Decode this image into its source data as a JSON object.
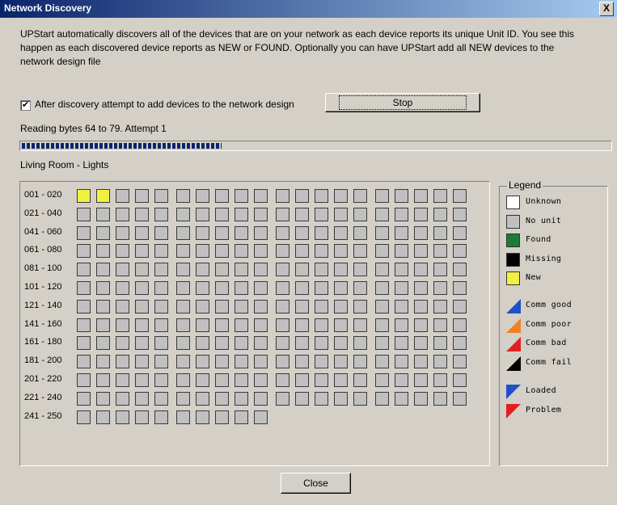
{
  "window": {
    "title": "Network Discovery",
    "close_glyph": "X"
  },
  "description": "UPStart automatically discovers all of the devices that are on your network as each device reports its unique Unit ID.  You see this happen as each discovered device reports as NEW or FOUND.  Optionally you can have UPStart add all NEW devices to the network design file",
  "add_devices": {
    "checked": true,
    "check_glyph": "✔",
    "label": "After discovery attempt to add devices to the network design"
  },
  "stop_label": "Stop",
  "status_text": "Reading bytes 64 to 79.  Attempt 1",
  "progress": {
    "fraction": 0.34
  },
  "room_name": "Living Room - Lights",
  "grid": {
    "rows": [
      {
        "label": "001 - 020",
        "count": 20,
        "states": [
          "new",
          "new"
        ]
      },
      {
        "label": "021 - 040",
        "count": 20
      },
      {
        "label": "041 - 060",
        "count": 20
      },
      {
        "label": "061 - 080",
        "count": 20
      },
      {
        "label": "081 - 100",
        "count": 20
      },
      {
        "label": "101 - 120",
        "count": 20
      },
      {
        "label": "121 - 140",
        "count": 20
      },
      {
        "label": "141 - 160",
        "count": 20
      },
      {
        "label": "161 - 180",
        "count": 20
      },
      {
        "label": "181 - 200",
        "count": 20
      },
      {
        "label": "201 - 220",
        "count": 20
      },
      {
        "label": "221 - 240",
        "count": 20
      },
      {
        "label": "241 - 250",
        "count": 10
      }
    ]
  },
  "legend": {
    "title": "Legend",
    "states": [
      {
        "label": "Unknown",
        "color": "#ffffff"
      },
      {
        "label": "No unit",
        "color": "#c0c0c0"
      },
      {
        "label": "Found",
        "color": "#1f7a3a"
      },
      {
        "label": "Missing",
        "color": "#000000"
      },
      {
        "label": "New",
        "color": "#f0f040"
      }
    ],
    "comm": [
      {
        "label": "Comm good",
        "color": "#2050c8"
      },
      {
        "label": "Comm poor",
        "color": "#f08020"
      },
      {
        "label": "Comm bad",
        "color": "#e02020"
      },
      {
        "label": "Comm fail",
        "color": "#000000"
      }
    ],
    "load": [
      {
        "label": "Loaded",
        "color": "#2050c8"
      },
      {
        "label": "Problem",
        "color": "#e02020"
      }
    ]
  },
  "close_label": "Close"
}
